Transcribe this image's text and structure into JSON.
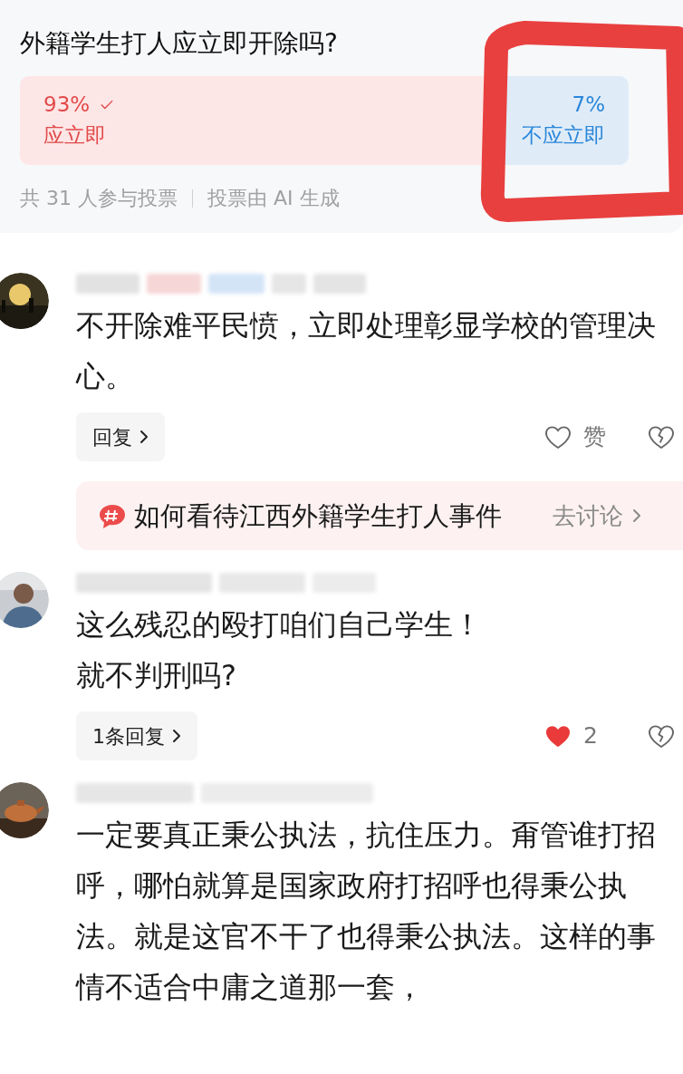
{
  "poll": {
    "question": "外籍学生打人应立即开除吗?",
    "options": [
      {
        "percent": "93%",
        "label": "应立即",
        "selected": true
      },
      {
        "percent": "7%",
        "label": "不应立即",
        "selected": false
      }
    ],
    "participants": "共 31 人参与投票",
    "note": "投票由 AI 生成"
  },
  "comments": [
    {
      "text": "不开除难平民愤，立即处理彰显学校的管理决心。",
      "reply_button": "回复",
      "like_label": "赞",
      "liked": false,
      "topic": {
        "title": "如何看待江西外籍学生打人事件",
        "action": "去讨论"
      }
    },
    {
      "lines": [
        "这么残忍的殴打咱们自己学生！",
        "就不判刑吗?"
      ],
      "reply_button": "1条回复",
      "like_label": "2",
      "liked": true
    },
    {
      "text": "一定要真正秉公执法，抗住压力。甭管谁打招呼，哪怕就算是国家政府打招呼也得秉公执法。就是这官不干了也得秉公执法。这样的事情不适合中庸之道那一套，"
    }
  ]
}
